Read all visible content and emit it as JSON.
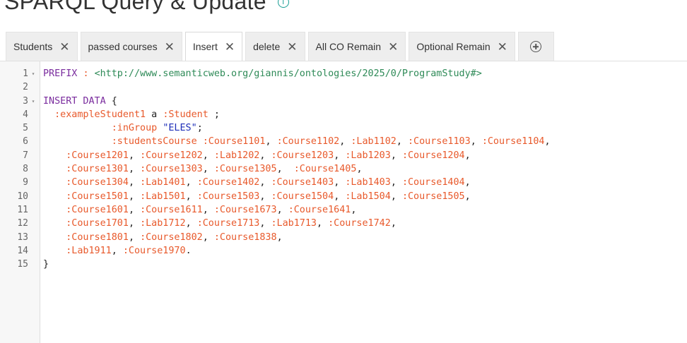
{
  "header": {
    "title": "SPARQL Query & Update",
    "info_icon": "info-icon"
  },
  "tabs": [
    {
      "label": "Students",
      "active": false
    },
    {
      "label": "passed courses",
      "active": false
    },
    {
      "label": "Insert",
      "active": true
    },
    {
      "label": "delete",
      "active": false
    },
    {
      "label": "All CO Remain",
      "active": false
    },
    {
      "label": "Optional Remain",
      "active": false
    }
  ],
  "tab_close_glyph": "✕",
  "editor": {
    "lines": [
      {
        "n": "1",
        "fold": "▾",
        "tokens": [
          {
            "t": "PREFIX ",
            "c": "kw"
          },
          {
            "t": ": ",
            "c": "pn"
          },
          {
            "t": "<http://www.semanticweb.org/giannis/ontologies/2025/0/ProgramStudy#>",
            "c": "iri"
          }
        ]
      },
      {
        "n": "2",
        "fold": "",
        "tokens": []
      },
      {
        "n": "3",
        "fold": "▾",
        "tokens": [
          {
            "t": "INSERT DATA ",
            "c": "kw"
          },
          {
            "t": "{",
            "c": "plain"
          }
        ]
      },
      {
        "n": "4",
        "fold": "",
        "tokens": [
          {
            "t": "  ",
            "c": "plain"
          },
          {
            "t": ":exampleStudent1",
            "c": "pn"
          },
          {
            "t": " a ",
            "c": "plain"
          },
          {
            "t": ":Student",
            "c": "pn"
          },
          {
            "t": " ;",
            "c": "plain"
          }
        ]
      },
      {
        "n": "5",
        "fold": "",
        "tokens": [
          {
            "t": "            ",
            "c": "plain"
          },
          {
            "t": ":inGroup",
            "c": "pn"
          },
          {
            "t": " ",
            "c": "plain"
          },
          {
            "t": "\"ELES\"",
            "c": "str"
          },
          {
            "t": ";",
            "c": "plain"
          }
        ]
      },
      {
        "n": "6",
        "fold": "",
        "tokens": [
          {
            "t": "            ",
            "c": "plain"
          },
          {
            "t": ":studentsCourse",
            "c": "pn"
          },
          {
            "t": " ",
            "c": "plain"
          },
          {
            "t": ":Course1101",
            "c": "pn"
          },
          {
            "t": ", ",
            "c": "plain"
          },
          {
            "t": ":Course1102",
            "c": "pn"
          },
          {
            "t": ", ",
            "c": "plain"
          },
          {
            "t": ":Lab1102",
            "c": "pn"
          },
          {
            "t": ", ",
            "c": "plain"
          },
          {
            "t": ":Course1103",
            "c": "pn"
          },
          {
            "t": ", ",
            "c": "plain"
          },
          {
            "t": ":Course1104",
            "c": "pn"
          },
          {
            "t": ",",
            "c": "plain"
          }
        ]
      },
      {
        "n": "7",
        "fold": "",
        "tokens": [
          {
            "t": "    ",
            "c": "plain"
          },
          {
            "t": ":Course1201",
            "c": "pn"
          },
          {
            "t": ", ",
            "c": "plain"
          },
          {
            "t": ":Course1202",
            "c": "pn"
          },
          {
            "t": ", ",
            "c": "plain"
          },
          {
            "t": ":Lab1202",
            "c": "pn"
          },
          {
            "t": ", ",
            "c": "plain"
          },
          {
            "t": ":Course1203",
            "c": "pn"
          },
          {
            "t": ", ",
            "c": "plain"
          },
          {
            "t": ":Lab1203",
            "c": "pn"
          },
          {
            "t": ", ",
            "c": "plain"
          },
          {
            "t": ":Course1204",
            "c": "pn"
          },
          {
            "t": ",",
            "c": "plain"
          }
        ]
      },
      {
        "n": "8",
        "fold": "",
        "tokens": [
          {
            "t": "    ",
            "c": "plain"
          },
          {
            "t": ":Course1301",
            "c": "pn"
          },
          {
            "t": ", ",
            "c": "plain"
          },
          {
            "t": ":Course1303",
            "c": "pn"
          },
          {
            "t": ", ",
            "c": "plain"
          },
          {
            "t": ":Course1305",
            "c": "pn"
          },
          {
            "t": ",  ",
            "c": "plain"
          },
          {
            "t": ":Course1405",
            "c": "pn"
          },
          {
            "t": ",",
            "c": "plain"
          }
        ]
      },
      {
        "n": "9",
        "fold": "",
        "tokens": [
          {
            "t": "    ",
            "c": "plain"
          },
          {
            "t": ":Course1304",
            "c": "pn"
          },
          {
            "t": ", ",
            "c": "plain"
          },
          {
            "t": ":Lab1401",
            "c": "pn"
          },
          {
            "t": ", ",
            "c": "plain"
          },
          {
            "t": ":Course1402",
            "c": "pn"
          },
          {
            "t": ", ",
            "c": "plain"
          },
          {
            "t": ":Course1403",
            "c": "pn"
          },
          {
            "t": ", ",
            "c": "plain"
          },
          {
            "t": ":Lab1403",
            "c": "pn"
          },
          {
            "t": ", ",
            "c": "plain"
          },
          {
            "t": ":Course1404",
            "c": "pn"
          },
          {
            "t": ",",
            "c": "plain"
          }
        ]
      },
      {
        "n": "10",
        "fold": "",
        "tokens": [
          {
            "t": "    ",
            "c": "plain"
          },
          {
            "t": ":Course1501",
            "c": "pn"
          },
          {
            "t": ", ",
            "c": "plain"
          },
          {
            "t": ":Lab1501",
            "c": "pn"
          },
          {
            "t": ", ",
            "c": "plain"
          },
          {
            "t": ":Course1503",
            "c": "pn"
          },
          {
            "t": ", ",
            "c": "plain"
          },
          {
            "t": ":Course1504",
            "c": "pn"
          },
          {
            "t": ", ",
            "c": "plain"
          },
          {
            "t": ":Lab1504",
            "c": "pn"
          },
          {
            "t": ", ",
            "c": "plain"
          },
          {
            "t": ":Course1505",
            "c": "pn"
          },
          {
            "t": ",",
            "c": "plain"
          }
        ]
      },
      {
        "n": "11",
        "fold": "",
        "tokens": [
          {
            "t": "    ",
            "c": "plain"
          },
          {
            "t": ":Course1601",
            "c": "pn"
          },
          {
            "t": ", ",
            "c": "plain"
          },
          {
            "t": ":Course1611",
            "c": "pn"
          },
          {
            "t": ", ",
            "c": "plain"
          },
          {
            "t": ":Course1673",
            "c": "pn"
          },
          {
            "t": ", ",
            "c": "plain"
          },
          {
            "t": ":Course1641",
            "c": "pn"
          },
          {
            "t": ",",
            "c": "plain"
          }
        ]
      },
      {
        "n": "12",
        "fold": "",
        "tokens": [
          {
            "t": "    ",
            "c": "plain"
          },
          {
            "t": ":Course1701",
            "c": "pn"
          },
          {
            "t": ", ",
            "c": "plain"
          },
          {
            "t": ":Lab1712",
            "c": "pn"
          },
          {
            "t": ", ",
            "c": "plain"
          },
          {
            "t": ":Course1713",
            "c": "pn"
          },
          {
            "t": ", ",
            "c": "plain"
          },
          {
            "t": ":Lab1713",
            "c": "pn"
          },
          {
            "t": ", ",
            "c": "plain"
          },
          {
            "t": ":Course1742",
            "c": "pn"
          },
          {
            "t": ",",
            "c": "plain"
          }
        ]
      },
      {
        "n": "13",
        "fold": "",
        "tokens": [
          {
            "t": "    ",
            "c": "plain"
          },
          {
            "t": ":Course1801",
            "c": "pn"
          },
          {
            "t": ", ",
            "c": "plain"
          },
          {
            "t": ":Course1802",
            "c": "pn"
          },
          {
            "t": ", ",
            "c": "plain"
          },
          {
            "t": ":Course1838",
            "c": "pn"
          },
          {
            "t": ",",
            "c": "plain"
          }
        ]
      },
      {
        "n": "14",
        "fold": "",
        "tokens": [
          {
            "t": "    ",
            "c": "plain"
          },
          {
            "t": ":Lab1911",
            "c": "pn"
          },
          {
            "t": ", ",
            "c": "plain"
          },
          {
            "t": ":Course1970",
            "c": "pn"
          },
          {
            "t": ".",
            "c": "plain"
          }
        ]
      },
      {
        "n": "15",
        "fold": "",
        "tokens": [
          {
            "t": "}",
            "c": "plain"
          }
        ]
      }
    ]
  }
}
